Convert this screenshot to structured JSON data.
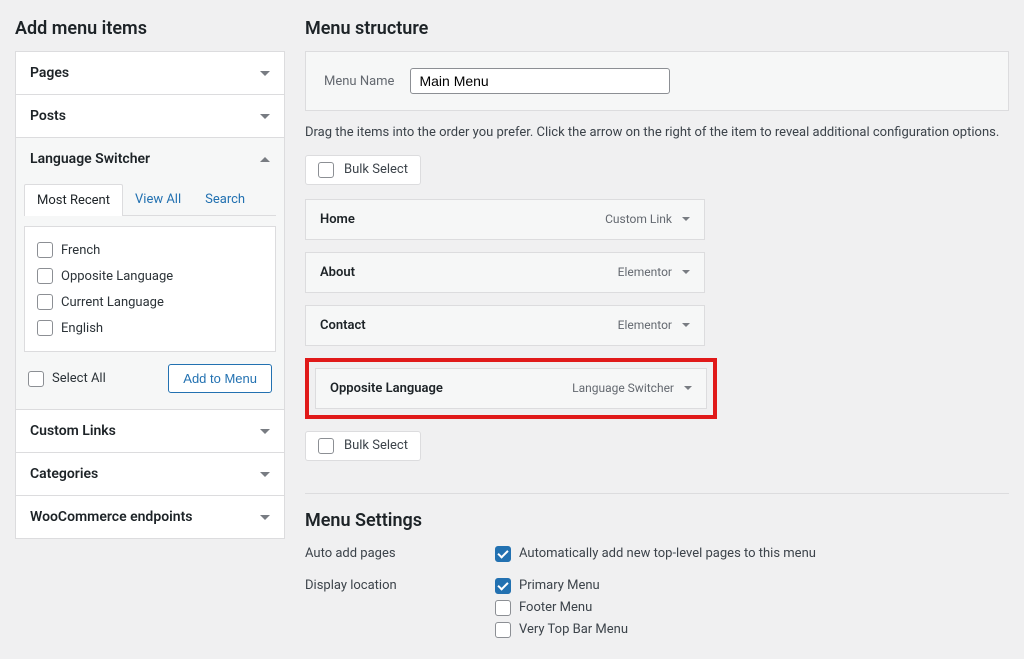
{
  "left": {
    "heading": "Add menu items",
    "panels": [
      {
        "title": "Pages",
        "open": false
      },
      {
        "title": "Posts",
        "open": false
      },
      {
        "title": "Language Switcher",
        "open": true
      },
      {
        "title": "Custom Links",
        "open": false
      },
      {
        "title": "Categories",
        "open": false
      },
      {
        "title": "WooCommerce endpoints",
        "open": false
      }
    ],
    "tabs": [
      "Most Recent",
      "View All",
      "Search"
    ],
    "active_tab": 0,
    "options": [
      {
        "label": "French",
        "checked": false
      },
      {
        "label": "Opposite Language",
        "checked": false
      },
      {
        "label": "Current Language",
        "checked": false
      },
      {
        "label": "English",
        "checked": false
      }
    ],
    "select_all": "Select All",
    "add_btn": "Add to Menu"
  },
  "right": {
    "heading": "Menu structure",
    "menu_name_label": "Menu Name",
    "menu_name_value": "Main Menu",
    "instructions": "Drag the items into the order you prefer. Click the arrow on the right of the item to reveal additional configuration options.",
    "bulk_select": "Bulk Select",
    "items": [
      {
        "title": "Home",
        "type": "Custom Link",
        "highlighted": false
      },
      {
        "title": "About",
        "type": "Elementor",
        "highlighted": false
      },
      {
        "title": "Contact",
        "type": "Elementor",
        "highlighted": false
      },
      {
        "title": "Opposite Language",
        "type": "Language Switcher",
        "highlighted": true
      }
    ],
    "settings_heading": "Menu Settings",
    "settings": {
      "auto_add": {
        "label": "Auto add pages",
        "option": "Automatically add new top-level pages to this menu",
        "checked": true
      },
      "display_location": {
        "label": "Display location",
        "options": [
          {
            "label": "Primary Menu",
            "checked": true
          },
          {
            "label": "Footer Menu",
            "checked": false
          },
          {
            "label": "Very Top Bar Menu",
            "checked": false
          }
        ]
      }
    }
  }
}
